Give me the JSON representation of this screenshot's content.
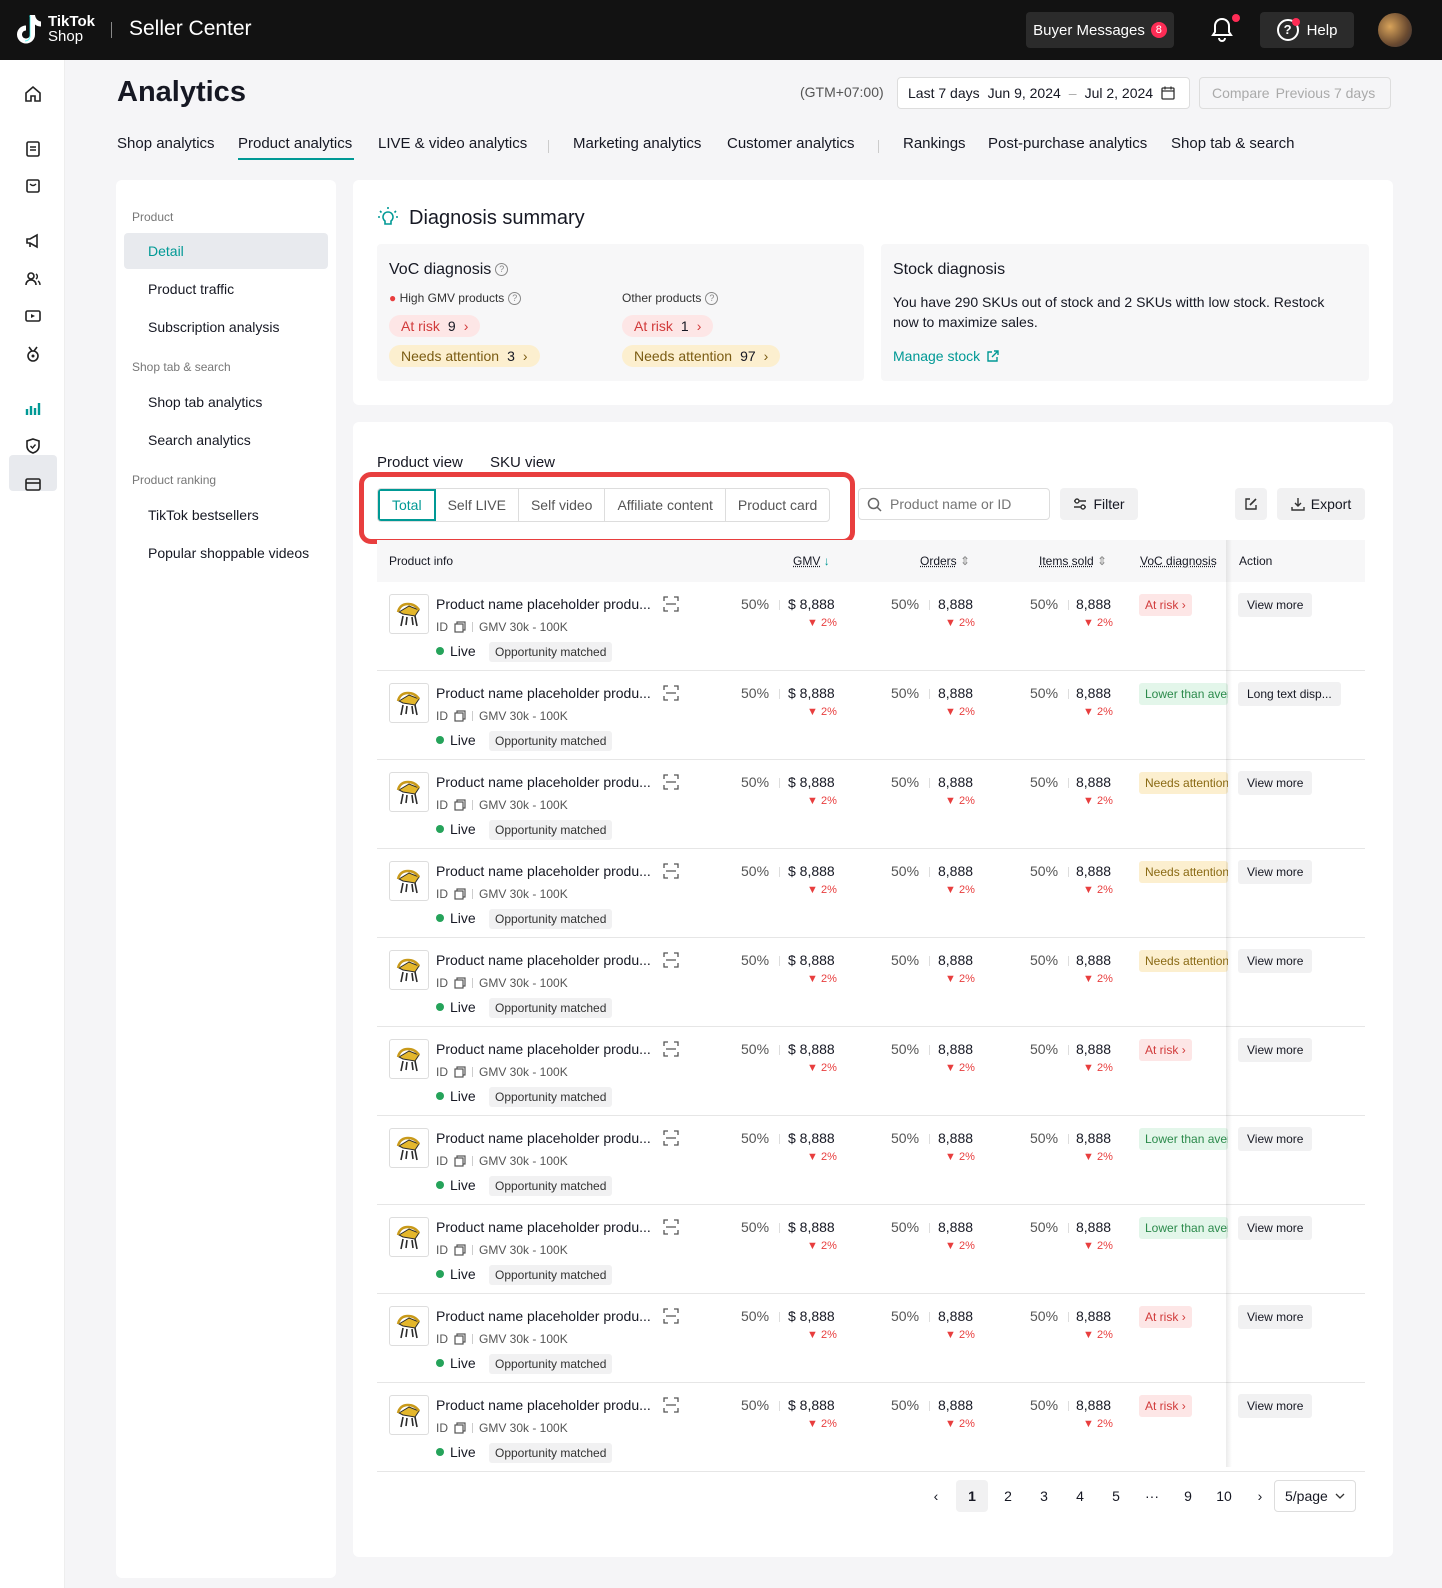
{
  "topbar": {
    "brand_top": "TikTok",
    "brand_bottom": "Shop",
    "product_name": "Seller Center",
    "buyer_messages": "Buyer Messages",
    "buyer_messages_count": "8",
    "help": "Help"
  },
  "header": {
    "title": "Analytics",
    "timezone": "(GTM+07:00)",
    "date_preset": "Last 7 days",
    "date_start": "Jun 9, 2024",
    "date_end": "Jul 2, 2024",
    "compare_label": "Compare",
    "compare_value": "Previous 7 days"
  },
  "nav_tabs": [
    {
      "label": "Shop analytics"
    },
    {
      "label": "Product analytics",
      "active": true
    },
    {
      "label": "LIVE & video analytics"
    },
    {
      "label": "Marketing analytics"
    },
    {
      "label": "Customer analytics"
    },
    {
      "label": "Rankings"
    },
    {
      "label": "Post-purchase analytics"
    },
    {
      "label": "Shop tab &  search"
    }
  ],
  "sidebar": {
    "groups": [
      {
        "label": "Product",
        "items": [
          "Detail",
          "Product traffic",
          "Subscription analysis"
        ]
      },
      {
        "label": "Shop tab & search",
        "items": [
          "Shop tab analytics",
          "Search analytics"
        ]
      },
      {
        "label": "Product ranking",
        "items": [
          "TikTok bestsellers",
          "Popular shoppable videos"
        ]
      }
    ],
    "active_item": "Detail"
  },
  "diagnosis": {
    "title": "Diagnosis summary",
    "voc": {
      "title": "VoC diagnosis",
      "high_gmv_label": "High GMV products",
      "other_label": "Other products",
      "at_risk_label": "At risk",
      "needs_attention_label": "Needs attention",
      "high_at_risk": "9",
      "high_needs_attention": "3",
      "other_at_risk": "1",
      "other_needs_attention": "97"
    },
    "stock": {
      "title": "Stock diagnosis",
      "text": "You have 290 SKUs out of stock and 2 SKUs witth low stock. Restock now to maximize sales.",
      "link": "Manage stock"
    }
  },
  "table": {
    "view_tabs": [
      "Product view",
      "SKU view"
    ],
    "segments": [
      "Total",
      "Self LIVE",
      "Self video",
      "Affiliate content",
      "Product card"
    ],
    "active_segment": "Total",
    "search_placeholder": "Product name or ID",
    "filter": "Filter",
    "export": "Export",
    "columns": {
      "product_info": "Product info",
      "gmv": "GMV",
      "orders": "Orders",
      "items_sold": "Items sold",
      "voc": "VoC diagnosis",
      "action": "Action"
    },
    "rows": [
      {
        "name": "Product name placeholder produ...",
        "id": "ID",
        "gmv_range": "GMV 30k - 100K",
        "status": "Live",
        "tag": "Opportunity matched",
        "gmv_pct": "50%",
        "gmv": "$ 8,888",
        "gmv_delta": "2%",
        "orders_pct": "50%",
        "orders": "8,888",
        "orders_delta": "2%",
        "items_pct": "50%",
        "items": "8,888",
        "items_delta": "2%",
        "voc": "At risk",
        "voc_type": "red",
        "action": "View more"
      },
      {
        "name": "Product name placeholder produ...",
        "id": "ID",
        "gmv_range": "GMV 30k - 100K",
        "status": "Live",
        "tag": "Opportunity matched",
        "gmv_pct": "50%",
        "gmv": "$ 8,888",
        "gmv_delta": "2%",
        "orders_pct": "50%",
        "orders": "8,888",
        "orders_delta": "2%",
        "items_pct": "50%",
        "items": "8,888",
        "items_delta": "2%",
        "voc": "Lower than average",
        "voc_type": "green",
        "action": "Long text disp..."
      },
      {
        "name": "Product name placeholder produ...",
        "id": "ID",
        "gmv_range": "GMV 30k - 100K",
        "status": "Live",
        "tag": "Opportunity matched",
        "gmv_pct": "50%",
        "gmv": "$ 8,888",
        "gmv_delta": "2%",
        "orders_pct": "50%",
        "orders": "8,888",
        "orders_delta": "2%",
        "items_pct": "50%",
        "items": "8,888",
        "items_delta": "2%",
        "voc": "Needs attention",
        "voc_type": "amber",
        "action": "View more"
      },
      {
        "name": "Product name placeholder produ...",
        "id": "ID",
        "gmv_range": "GMV 30k - 100K",
        "status": "Live",
        "tag": "Opportunity matched",
        "gmv_pct": "50%",
        "gmv": "$ 8,888",
        "gmv_delta": "2%",
        "orders_pct": "50%",
        "orders": "8,888",
        "orders_delta": "2%",
        "items_pct": "50%",
        "items": "8,888",
        "items_delta": "2%",
        "voc": "Needs attention",
        "voc_type": "amber",
        "action": "View more"
      },
      {
        "name": "Product name placeholder produ...",
        "id": "ID",
        "gmv_range": "GMV 30k - 100K",
        "status": "Live",
        "tag": "Opportunity matched",
        "gmv_pct": "50%",
        "gmv": "$ 8,888",
        "gmv_delta": "2%",
        "orders_pct": "50%",
        "orders": "8,888",
        "orders_delta": "2%",
        "items_pct": "50%",
        "items": "8,888",
        "items_delta": "2%",
        "voc": "Needs attention",
        "voc_type": "amber",
        "action": "View more"
      },
      {
        "name": "Product name placeholder produ...",
        "id": "ID",
        "gmv_range": "GMV 30k - 100K",
        "status": "Live",
        "tag": "Opportunity matched",
        "gmv_pct": "50%",
        "gmv": "$ 8,888",
        "gmv_delta": "2%",
        "orders_pct": "50%",
        "orders": "8,888",
        "orders_delta": "2%",
        "items_pct": "50%",
        "items": "8,888",
        "items_delta": "2%",
        "voc": "At risk",
        "voc_type": "red",
        "action": "View more"
      },
      {
        "name": "Product name placeholder produ...",
        "id": "ID",
        "gmv_range": "GMV 30k - 100K",
        "status": "Live",
        "tag": "Opportunity matched",
        "gmv_pct": "50%",
        "gmv": "$ 8,888",
        "gmv_delta": "2%",
        "orders_pct": "50%",
        "orders": "8,888",
        "orders_delta": "2%",
        "items_pct": "50%",
        "items": "8,888",
        "items_delta": "2%",
        "voc": "Lower than average",
        "voc_type": "green",
        "action": "View more"
      },
      {
        "name": "Product name placeholder produ...",
        "id": "ID",
        "gmv_range": "GMV 30k - 100K",
        "status": "Live",
        "tag": "Opportunity matched",
        "gmv_pct": "50%",
        "gmv": "$ 8,888",
        "gmv_delta": "2%",
        "orders_pct": "50%",
        "orders": "8,888",
        "orders_delta": "2%",
        "items_pct": "50%",
        "items": "8,888",
        "items_delta": "2%",
        "voc": "Lower than average",
        "voc_type": "green",
        "action": "View more"
      },
      {
        "name": "Product name placeholder produ...",
        "id": "ID",
        "gmv_range": "GMV 30k - 100K",
        "status": "Live",
        "tag": "Opportunity matched",
        "gmv_pct": "50%",
        "gmv": "$ 8,888",
        "gmv_delta": "2%",
        "orders_pct": "50%",
        "orders": "8,888",
        "orders_delta": "2%",
        "items_pct": "50%",
        "items": "8,888",
        "items_delta": "2%",
        "voc": "At risk",
        "voc_type": "red",
        "action": "View more"
      },
      {
        "name": "Product name placeholder produ...",
        "id": "ID",
        "gmv_range": "GMV 30k - 100K",
        "status": "Live",
        "tag": "Opportunity matched",
        "gmv_pct": "50%",
        "gmv": "$ 8,888",
        "gmv_delta": "2%",
        "orders_pct": "50%",
        "orders": "8,888",
        "orders_delta": "2%",
        "items_pct": "50%",
        "items": "8,888",
        "items_delta": "2%",
        "voc": "At risk",
        "voc_type": "red",
        "action": "View more"
      }
    ],
    "pagination": {
      "pages": [
        "1",
        "2",
        "3",
        "4",
        "5",
        "···",
        "9",
        "10"
      ],
      "current": "1",
      "per_page": "5/page"
    }
  },
  "colors": {
    "accent": "#009995",
    "danger": "#fe2c55",
    "highlight_border": "#e83e3e"
  },
  "icons": [
    "home-icon",
    "orders-icon",
    "products-icon",
    "marketing-icon",
    "customers-icon",
    "live-icon",
    "rewards-icon",
    "analytics-icon",
    "shield-icon",
    "finance-icon",
    "bell-icon",
    "help-icon",
    "calendar-icon",
    "bulb-icon",
    "external-link-icon",
    "search-icon",
    "filter-icon",
    "edit-icon",
    "download-icon",
    "scan-icon",
    "copy-icon",
    "chair-icon",
    "chevron-right-icon",
    "chevron-left-icon",
    "chevron-down-icon",
    "sort-icon"
  ]
}
